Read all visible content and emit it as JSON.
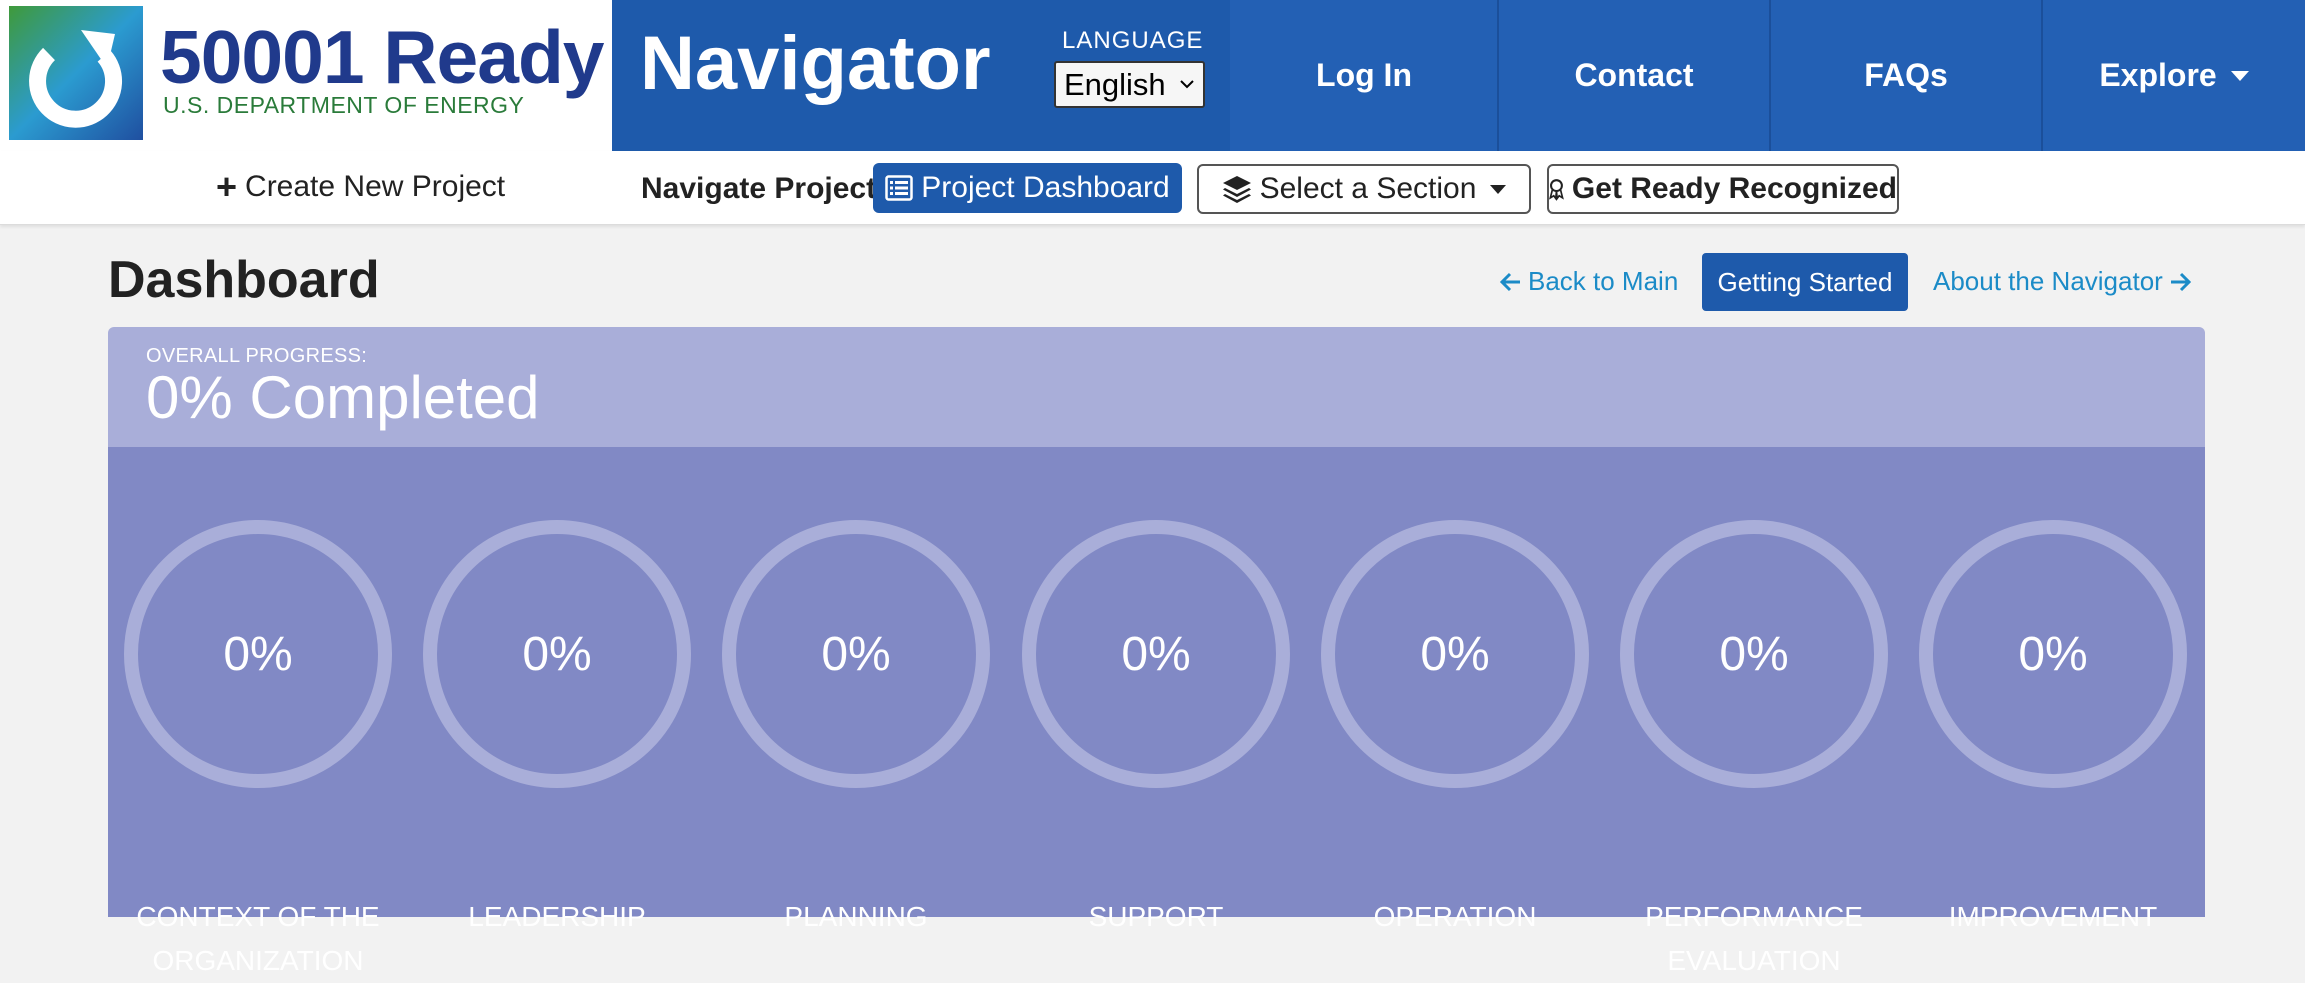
{
  "logo": {
    "title": "50001 Ready",
    "subtitle": "U.S. DEPARTMENT OF ENERGY",
    "mark_icon": "circular-arrow-logo-icon",
    "colors": {
      "blue": "#203a8c",
      "green": "#2a7b3a"
    }
  },
  "header": {
    "brand": "Navigator",
    "language_label": "LANGUAGE",
    "language_value": "English",
    "nav": {
      "login": "Log In",
      "contact": "Contact",
      "faqs": "FAQs",
      "explore": "Explore"
    },
    "colors": {
      "bar": "#1e5aab",
      "item": "#2360b4"
    }
  },
  "subbar": {
    "create_label": "Create New Project",
    "navigate_label": "Navigate Project:",
    "dashboard_label": "Project Dashboard",
    "section_label": "Select a Section",
    "ready_label": "Get Ready Recognized"
  },
  "page": {
    "title": "Dashboard",
    "back_label": "Back to Main",
    "started_label": "Getting Started",
    "about_label": "About the Navigator"
  },
  "progress": {
    "overall_label": "OVERALL PROGRESS:",
    "overall_value": "0% Completed",
    "overall_fraction": 0,
    "colors": {
      "header": "#a9aed9",
      "body": "#8189c5",
      "ring_track": "#a9aed9"
    },
    "sections": [
      {
        "label_line1": "CONTEXT OF THE",
        "label_line2": "ORGANIZATION",
        "value": "0%",
        "fraction": 0
      },
      {
        "label_line1": "LEADERSHIP",
        "label_line2": "",
        "value": "0%",
        "fraction": 0
      },
      {
        "label_line1": "PLANNING",
        "label_line2": "",
        "value": "0%",
        "fraction": 0
      },
      {
        "label_line1": "SUPPORT",
        "label_line2": "",
        "value": "0%",
        "fraction": 0
      },
      {
        "label_line1": "OPERATION",
        "label_line2": "",
        "value": "0%",
        "fraction": 0
      },
      {
        "label_line1": "PERFORMANCE",
        "label_line2": "EVALUATION",
        "value": "0%",
        "fraction": 0
      },
      {
        "label_line1": "IMPROVEMENT",
        "label_line2": "",
        "value": "0%",
        "fraction": 0
      }
    ]
  }
}
